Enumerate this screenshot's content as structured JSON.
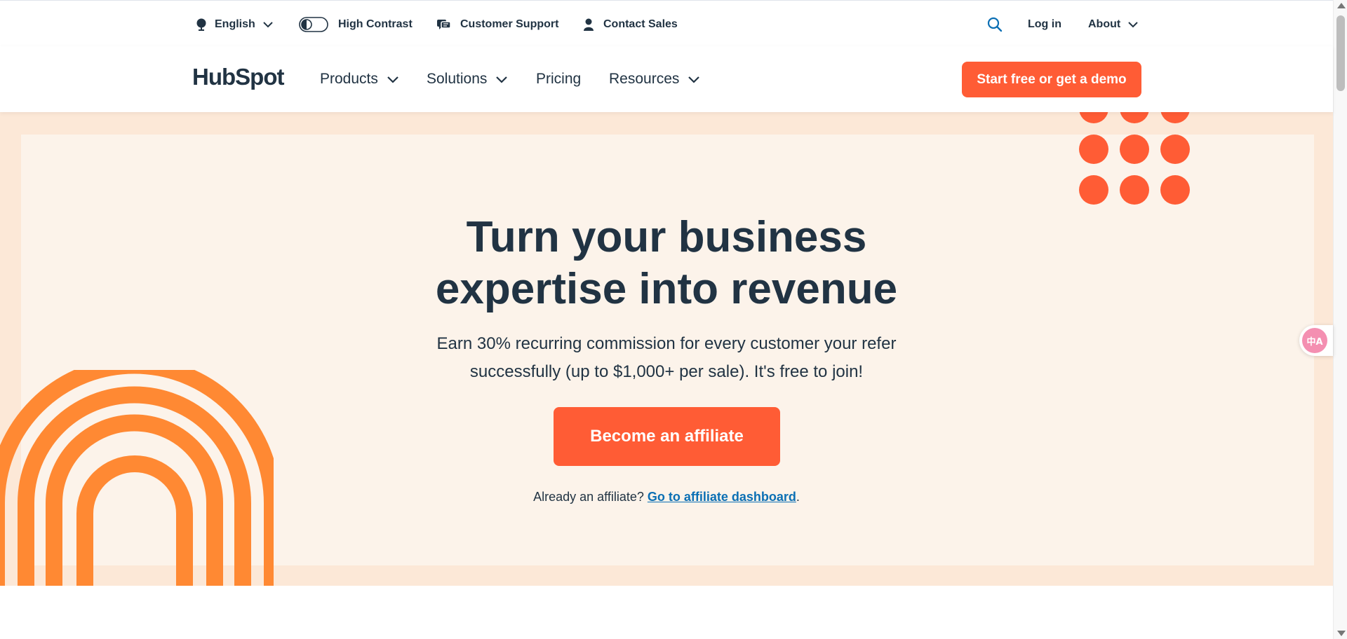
{
  "utility_bar": {
    "language": {
      "label": "English",
      "icon": "globe-icon"
    },
    "high_contrast": {
      "label": "High Contrast",
      "icon": "toggle-icon"
    },
    "customer_support": {
      "label": "Customer Support",
      "icon": "chat-bubbles-icon"
    },
    "contact_sales": {
      "label": "Contact Sales",
      "icon": "person-icon"
    },
    "search": {
      "icon": "search-icon"
    },
    "login": {
      "label": "Log in"
    },
    "about": {
      "label": "About"
    }
  },
  "nav": {
    "logo_text": "HubSpot",
    "items": [
      {
        "label": "Products",
        "has_dropdown": true
      },
      {
        "label": "Solutions",
        "has_dropdown": true
      },
      {
        "label": "Pricing",
        "has_dropdown": false
      },
      {
        "label": "Resources",
        "has_dropdown": true
      }
    ],
    "cta_label": "Start free or get a demo"
  },
  "hero": {
    "headline_line1": "Turn your business",
    "headline_line2": "expertise into revenue",
    "subtext_line1": "Earn 30% recurring commission for every customer your refer",
    "subtext_line2": "successfully (up to $1,000+ per sale). It's free to join!",
    "cta_label": "Become an affiliate",
    "already_text": "Already an affiliate? ",
    "dashboard_link": "Go to affiliate dashboard",
    "trailing_period": "."
  },
  "translate_widget": {
    "label": "中A",
    "icon": "translate-icon"
  },
  "colors": {
    "brand_orange": "#ff5c35",
    "arch_orange": "#ff8933",
    "text_dark": "#213343",
    "link_blue": "#0b6fb4",
    "hero_outer_bg": "#fce8d7",
    "hero_inner_bg": "#fcf3ea"
  }
}
